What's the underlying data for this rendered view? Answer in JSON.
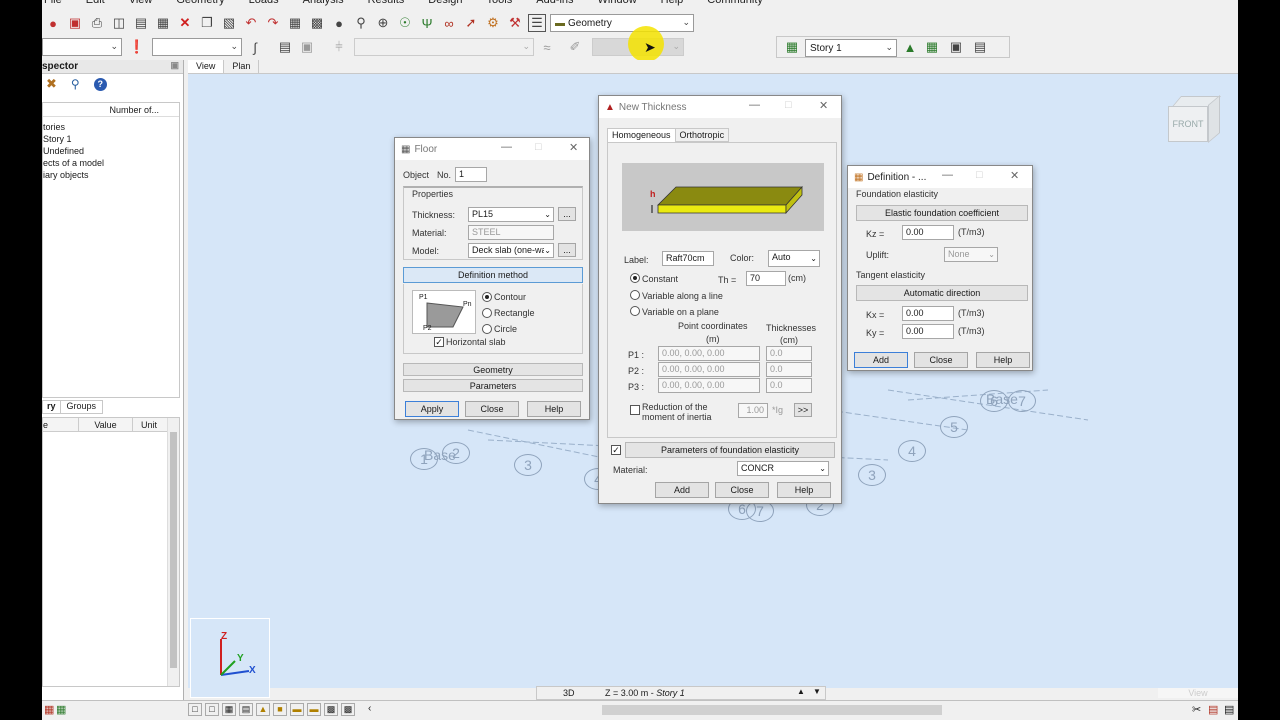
{
  "menu": [
    "File",
    "Edit",
    "View",
    "Geometry",
    "Loads",
    "Analysis",
    "Results",
    "Design",
    "Tools",
    "Add-ins",
    "Window",
    "Help",
    "Community"
  ],
  "toolbar": {
    "layout_select": "Geometry",
    "story_select": "Story 1"
  },
  "inspector": {
    "title": "spector",
    "column": "Number of...",
    "tree": [
      "tories",
      "Story 1",
      "Undefined",
      "ects of a model",
      "iary objects"
    ],
    "tabs": [
      "ry",
      "Groups"
    ],
    "grid_headers": [
      "e",
      "Value",
      "Unit"
    ]
  },
  "view_tabs": [
    "View",
    "Plan"
  ],
  "viewcube": "FRONT",
  "floor": {
    "title": "Floor",
    "object_label": "Object",
    "no_label": "No.",
    "no_value": "1",
    "properties": "Properties",
    "thickness_label": "Thickness:",
    "thickness_value": "PL15",
    "material_label": "Material:",
    "material_value": "STEEL",
    "model_label": "Model:",
    "model_value": "Deck slab (one-wa",
    "definition_method": "Definition method",
    "options": [
      "Contour",
      "Rectangle",
      "Circle"
    ],
    "horizontal_slab": "Horizontal slab",
    "geometry": "Geometry",
    "parameters": "Parameters",
    "apply": "Apply",
    "close": "Close",
    "help": "Help",
    "p1": "P1",
    "pn": "Pn",
    "p2": "P2"
  },
  "thickness": {
    "title": "New Thickness",
    "tab_homogeneous": "Homogeneous",
    "tab_orthotropic": "Orthotropic",
    "h_marker": "h",
    "label_label": "Label:",
    "label_value": "Raft70cm",
    "color_label": "Color:",
    "color_value": "Auto",
    "constant": "Constant",
    "th_label": "Th =",
    "th_value": "70",
    "th_unit": "(cm)",
    "variable_line": "Variable along a line",
    "variable_plane": "Variable on a plane",
    "point_coords": "Point coordinates",
    "point_unit": "(m)",
    "thicknesses": "Thicknesses",
    "thick_unit": "(cm)",
    "points": [
      {
        "name": "P1 :",
        "coord": "0.00, 0.00, 0.00",
        "th": "0.0"
      },
      {
        "name": "P2 :",
        "coord": "0.00, 0.00, 0.00",
        "th": "0.0"
      },
      {
        "name": "P3 :",
        "coord": "0.00, 0.00, 0.00",
        "th": "0.0"
      }
    ],
    "reduction_1": "Reduction of the",
    "reduction_2": "moment of inertia",
    "reduction_value": "1.00",
    "reduction_unit": "*Ig",
    "more": ">>",
    "foundation_params": "Parameters of foundation elasticity",
    "material_label": "Material:",
    "material_value": "CONCR",
    "add": "Add",
    "close": "Close",
    "help": "Help"
  },
  "definition": {
    "title": "Definition - ...",
    "foundation_elasticity": "Foundation elasticity",
    "elastic_coeff": "Elastic foundation coefficient",
    "kz_label": "Kz =",
    "kz_value": "0.00",
    "unit": "(T/m3)",
    "uplift_label": "Uplift:",
    "uplift_value": "None",
    "tangent_elasticity": "Tangent elasticity",
    "automatic_direction": "Automatic direction",
    "kx_label": "Kx =",
    "kx_value": "0.00",
    "ky_label": "Ky =",
    "ky_value": "0.00",
    "add": "Add",
    "close": "Close",
    "help": "Help"
  },
  "axes_labels": {
    "z": "Z",
    "y": "Y",
    "x": "X"
  },
  "grid_labels": [
    "Base",
    "1",
    "2",
    "3",
    "4",
    "5",
    "Base",
    "6",
    "7",
    "4",
    "3",
    "6",
    "7",
    "2"
  ],
  "status": {
    "mode": "3D",
    "level": "Z = 3.00 m - ",
    "story": "Story 1",
    "view": "View"
  }
}
